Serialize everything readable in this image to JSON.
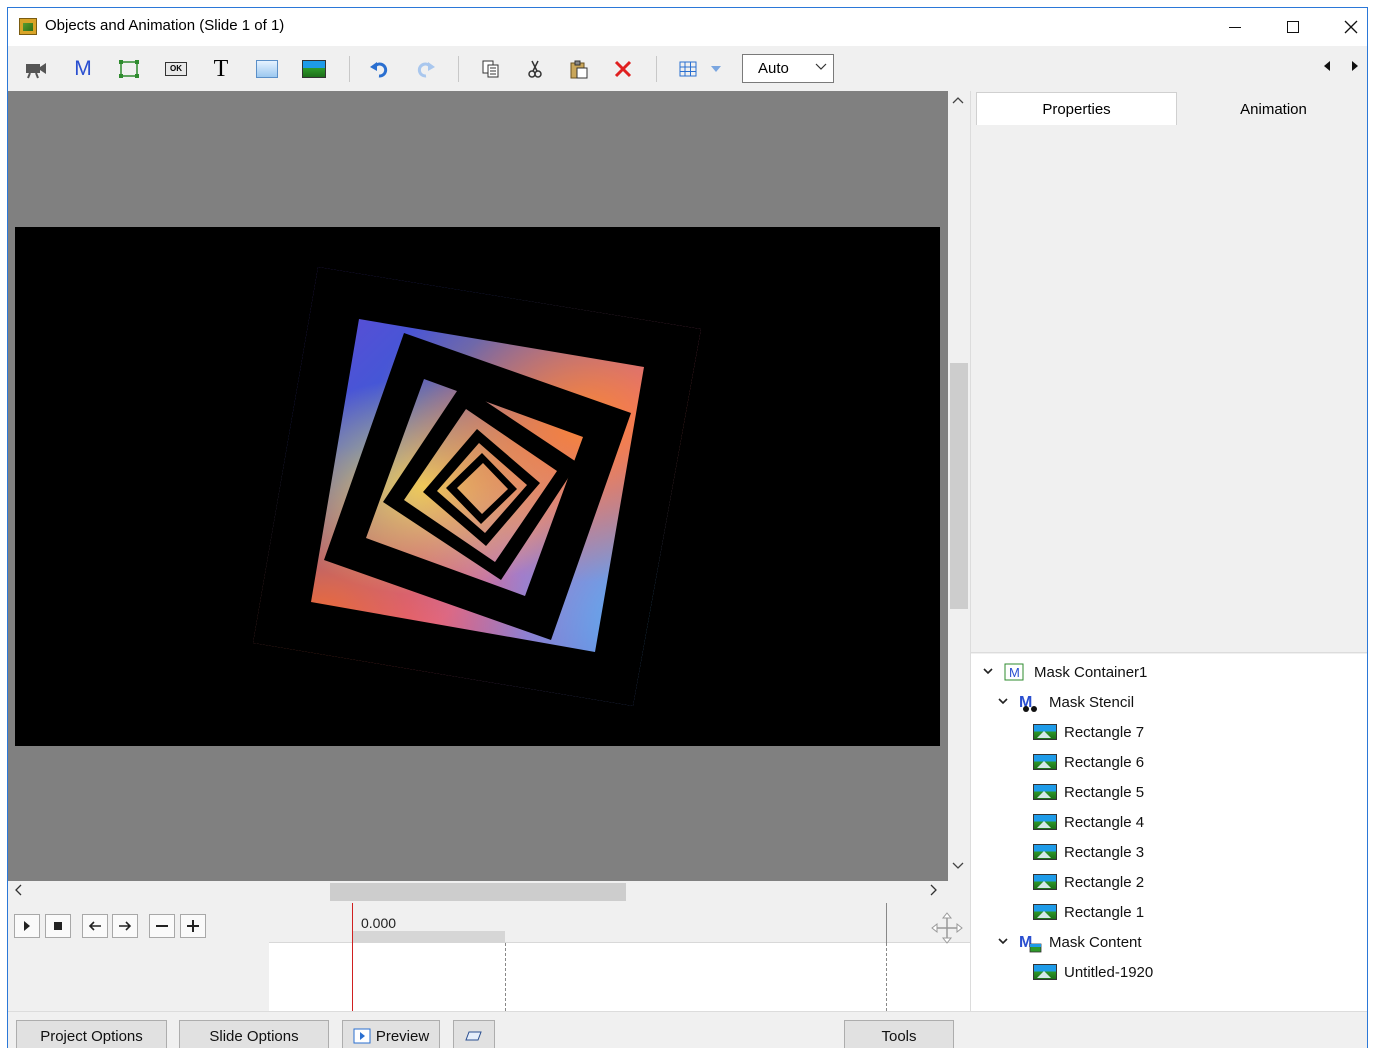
{
  "window": {
    "title": "Objects and Animation (Slide 1 of 1)",
    "accent_color": "#2b78d8"
  },
  "toolbar": {
    "icons": [
      "camera-icon",
      "mask-m-icon",
      "frame-icon",
      "button-ok-icon",
      "text-t-icon",
      "rectangle-icon",
      "image-icon",
      "undo-icon",
      "redo-icon",
      "copy-icon",
      "cut-icon",
      "paste-icon",
      "delete-icon",
      "grid-icon",
      "dropdown-arrow-icon"
    ],
    "text_icon_label": "T",
    "mask_icon_label": "M",
    "ok_icon_label": "OK",
    "zoom_select": "Auto"
  },
  "timeline": {
    "time": "0.000"
  },
  "right_panel": {
    "tabs": [
      "Properties",
      "Animation"
    ],
    "active_tab": "Properties",
    "tree": [
      {
        "label": "Mask Container1",
        "level": 0,
        "expanded": true,
        "icon": "mask-container-icon"
      },
      {
        "label": "Mask Stencil",
        "level": 1,
        "expanded": true,
        "icon": "mask-stencil-icon"
      },
      {
        "label": "Rectangle 7",
        "level": 2,
        "icon": "image-icon"
      },
      {
        "label": "Rectangle 6",
        "level": 2,
        "icon": "image-icon"
      },
      {
        "label": "Rectangle 5",
        "level": 2,
        "icon": "image-icon"
      },
      {
        "label": "Rectangle 4",
        "level": 2,
        "icon": "image-icon"
      },
      {
        "label": "Rectangle 3",
        "level": 2,
        "icon": "image-icon"
      },
      {
        "label": "Rectangle 2",
        "level": 2,
        "icon": "image-icon"
      },
      {
        "label": "Rectangle 1",
        "level": 2,
        "icon": "image-icon"
      },
      {
        "label": "Mask Content",
        "level": 1,
        "expanded": true,
        "icon": "mask-content-icon"
      },
      {
        "label": "Untitled-1920",
        "level": 2,
        "icon": "image-icon"
      }
    ]
  },
  "bottom": {
    "project_options": "Project Options",
    "slide_options": "Slide Options",
    "preview": "Preview",
    "tools": "Tools"
  }
}
